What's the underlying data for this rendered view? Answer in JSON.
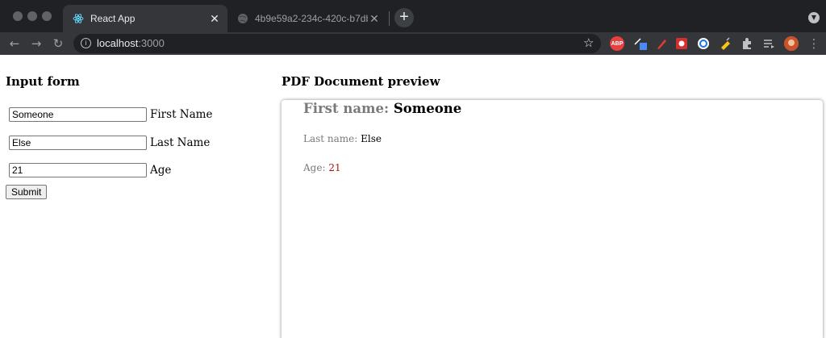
{
  "browser": {
    "tabs": [
      {
        "title": "React App",
        "active": true
      },
      {
        "title": "4b9e59a2-234c-420c-b7db-",
        "active": false
      }
    ],
    "new_tab_label": "+",
    "url_host": "localhost",
    "url_port": ":3000",
    "extensions": {
      "abp_label": "ABP"
    },
    "icons": [
      "back-icon",
      "forward-icon",
      "reload-icon",
      "info-icon",
      "star-icon",
      "puzzle-icon",
      "menu-icon"
    ]
  },
  "form": {
    "heading": "Input form",
    "fields": [
      {
        "value": "Someone",
        "label": "First Name"
      },
      {
        "value": "Else",
        "label": "Last Name"
      },
      {
        "value": "21",
        "label": "Age"
      }
    ],
    "submit_label": "Submit"
  },
  "preview": {
    "heading": "PDF Document preview",
    "first_name_label": "First name:",
    "first_name_value": "Someone",
    "last_name_label": "Last name:",
    "last_name_value": "Else",
    "age_label": "Age:",
    "age_value": "21"
  },
  "colors": {
    "chrome_dark": "#202124",
    "chrome_toolbar": "#35363a",
    "label_gray": "#7a7a7a",
    "age_red": "#b21212"
  }
}
